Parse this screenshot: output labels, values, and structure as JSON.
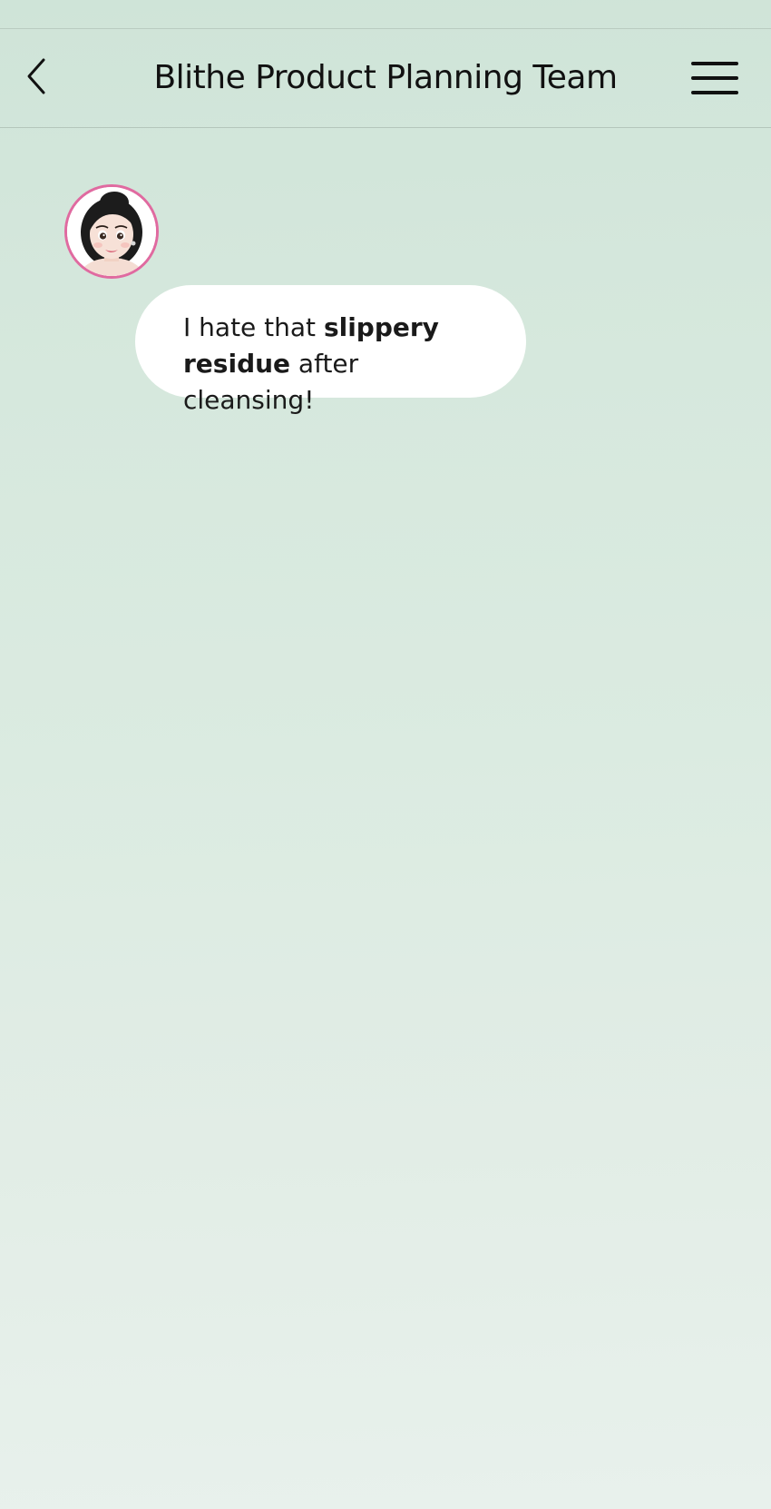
{
  "header": {
    "title": "Blithe Product Planning Team",
    "back_icon": "chevron-left-icon",
    "menu_icon": "hamburger-menu-icon"
  },
  "messages": [
    {
      "avatar_icon": "woman-memoji-avatar",
      "avatar_ring_color": "#e06aa0",
      "segments": [
        {
          "text": "I hate that ",
          "bold": false
        },
        {
          "text": "slippery residue",
          "bold": true
        },
        {
          "text": " after cleansing!",
          "bold": false
        }
      ]
    }
  ],
  "colors": {
    "background_top": "#cfe4d8",
    "background_bottom": "#e8f1ec",
    "bubble": "#ffffff",
    "text": "#111111"
  }
}
